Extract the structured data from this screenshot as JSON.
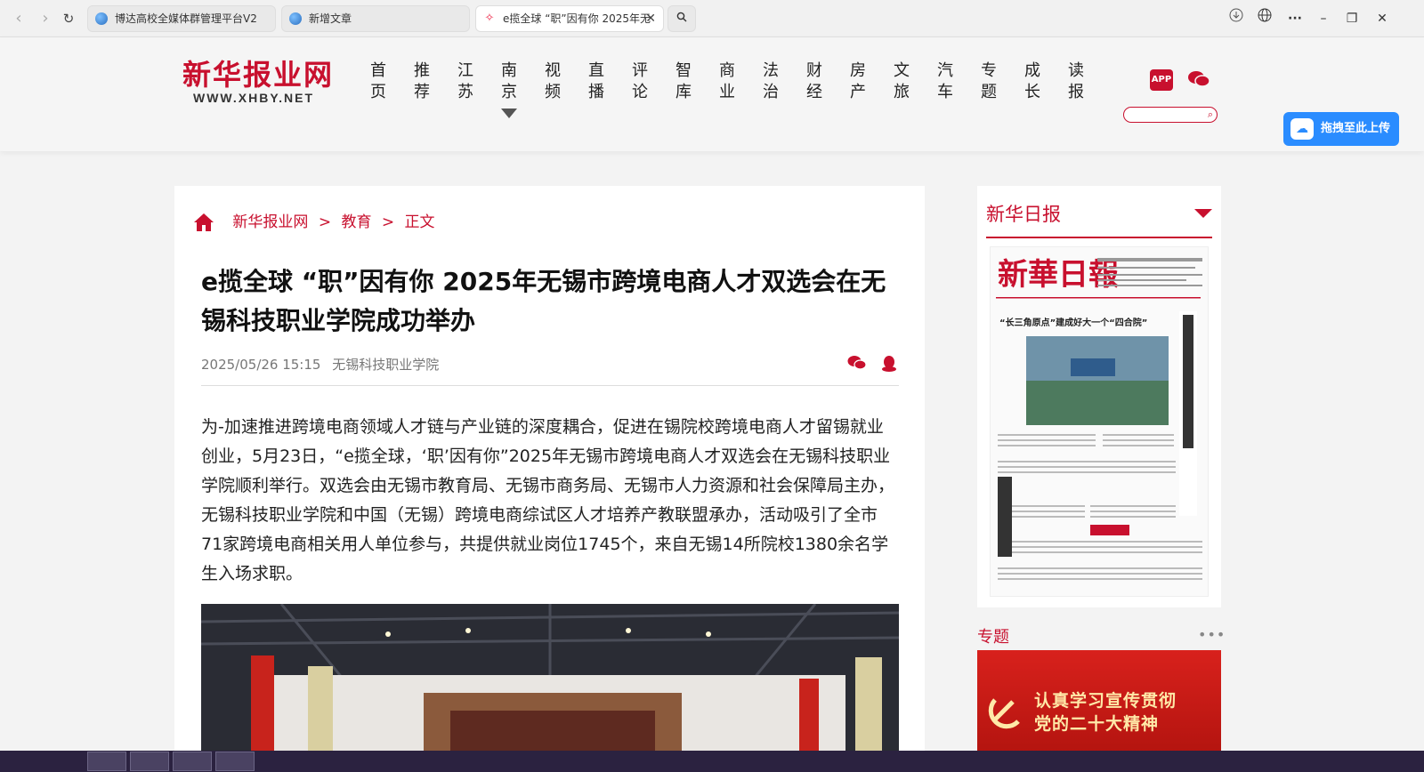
{
  "browser": {
    "tabs": [
      {
        "label": "博达高校全媒体群管理平台V2",
        "favicon": "globe-icon"
      },
      {
        "label": "新增文章",
        "favicon": "globe-icon"
      },
      {
        "label": "e揽全球 “职”因有你 2025年无",
        "favicon": "ai-icon"
      }
    ],
    "close_glyph": "✕",
    "search_glyph": "🔍"
  },
  "site": {
    "logo_cn": "新华报业网",
    "logo_en": "WWW.XHBY.NET",
    "nav": [
      {
        "top": "首",
        "bottom": "页"
      },
      {
        "top": "推",
        "bottom": "荐"
      },
      {
        "top": "江",
        "bottom": "苏"
      },
      {
        "top": "南",
        "bottom": "京"
      },
      {
        "top": "视",
        "bottom": "频"
      },
      {
        "top": "直",
        "bottom": "播"
      },
      {
        "top": "评",
        "bottom": "论"
      },
      {
        "top": "智",
        "bottom": "库"
      },
      {
        "top": "商",
        "bottom": "业"
      },
      {
        "top": "法",
        "bottom": "治"
      },
      {
        "top": "财",
        "bottom": "经"
      },
      {
        "top": "房",
        "bottom": "产"
      },
      {
        "top": "文",
        "bottom": "旅"
      },
      {
        "top": "汽",
        "bottom": "车"
      },
      {
        "top": "专",
        "bottom": "题"
      },
      {
        "top": "成",
        "bottom": "长"
      },
      {
        "top": "读",
        "bottom": "报"
      }
    ],
    "app_label": "APP",
    "search_placeholder": "",
    "upload_label": "拖拽至此上传",
    "brand_color": "#c8102e"
  },
  "article": {
    "breadcrumb": {
      "site": "新华报业网",
      "sep": ">",
      "section": "教育",
      "page": "正文"
    },
    "title": "e揽全球 “职”因有你 2025年无锡市跨境电商人才双选会在无锡科技职业学院成功举办",
    "date": "2025/05/26 15:15",
    "source": "无锡科技职业学院",
    "body": "为-加速推进跨境电商领域人才链与产业链的深度耦合，促进在锡院校跨境电商人才留锡就业创业，5月23日，“e揽全球，‘职’因有你”2025年无锡市跨境电商人才双选会在无锡科技职业学院顺利举行。双选会由无锡市教育局、无锡市商务局、无锡市人力资源和社会保障局主办，无锡科技职业学院和中国（无锡）跨境电商综试区人才培养产教联盟承办，活动吸引了全市71家跨境电商相关用人单位参与，共提供就业岗位1745个，来自无锡14所院校1380余名学生入场求职。"
  },
  "sidebar": {
    "paper_title": "新华日报",
    "paper_masthead": "新華日報",
    "paper_headline": "“长三角原点”建成好大一个“四合院”",
    "special_title": "专题",
    "special_more": "•••",
    "banner_line1": "认真学习宣传贯彻",
    "banner_line2": "党的二十大精神"
  }
}
